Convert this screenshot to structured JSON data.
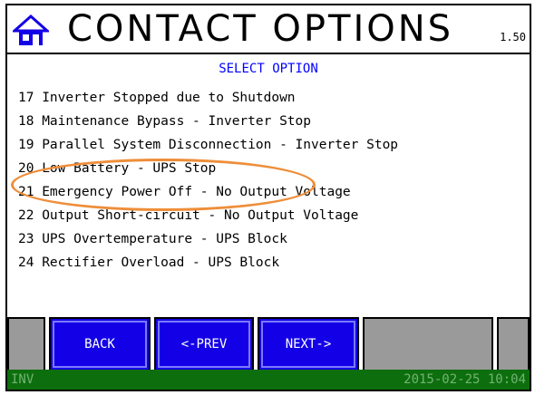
{
  "header": {
    "title": "CONTACT OPTIONS",
    "version": "1.50",
    "home_icon": "home-icon"
  },
  "select_heading": "SELECT OPTION",
  "options": [
    "17 Inverter Stopped due to Shutdown",
    "18 Maintenance Bypass - Inverter Stop",
    "19 Parallel System Disconnection - Inverter Stop",
    "20 Low Battery - UPS Stop",
    "21 Emergency Power Off - No Output Voltage",
    "22 Output Short-circuit - No Output Voltage",
    "23 UPS Overtemperature - UPS Block",
    "24 Rectifier Overload - UPS Block"
  ],
  "highlighted_option": "20 Low Battery - UPS Stop",
  "buttons": {
    "back": "BACK",
    "prev": "<-PREV",
    "next": "NEXT->"
  },
  "status": {
    "mode": "INV",
    "datetime": "2015-02-25 10:04"
  },
  "colors": {
    "accent_blue": "#1400e6",
    "heading_blue": "#0000ff",
    "highlight_orange": "#ee8e3a",
    "status_green": "#0d6e0d",
    "button_gray": "#9a9a9a"
  }
}
